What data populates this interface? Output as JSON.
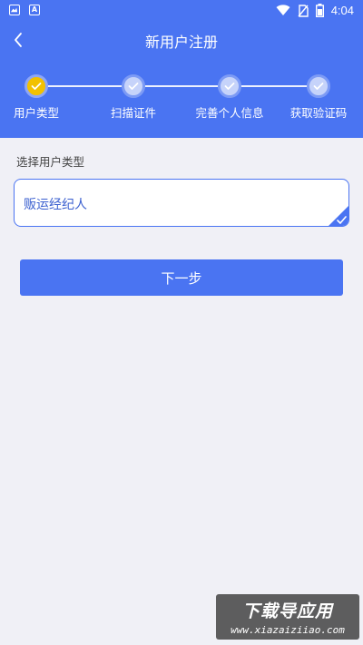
{
  "status_bar": {
    "time": "4:04",
    "icons": [
      "image-icon",
      "font-icon",
      "wifi-icon",
      "no-sim-icon",
      "battery-icon"
    ]
  },
  "header": {
    "title": "新用户注册",
    "back_icon": "chevron-left-icon"
  },
  "steps": [
    {
      "label": "用户类型",
      "state": "active"
    },
    {
      "label": "扫描证件",
      "state": "pending"
    },
    {
      "label": "完善个人信息",
      "state": "pending"
    },
    {
      "label": "获取验证码",
      "state": "pending"
    }
  ],
  "form": {
    "section_label": "选择用户类型",
    "selected_value": "贩运经纪人"
  },
  "next_button": {
    "label": "下一步"
  },
  "watermark": {
    "title": "下载导应用",
    "url": "www.xiazaiziiao.com"
  },
  "colors": {
    "primary": "#4a74f2",
    "active_step": "#f2c100",
    "background": "#f0f0f6"
  }
}
